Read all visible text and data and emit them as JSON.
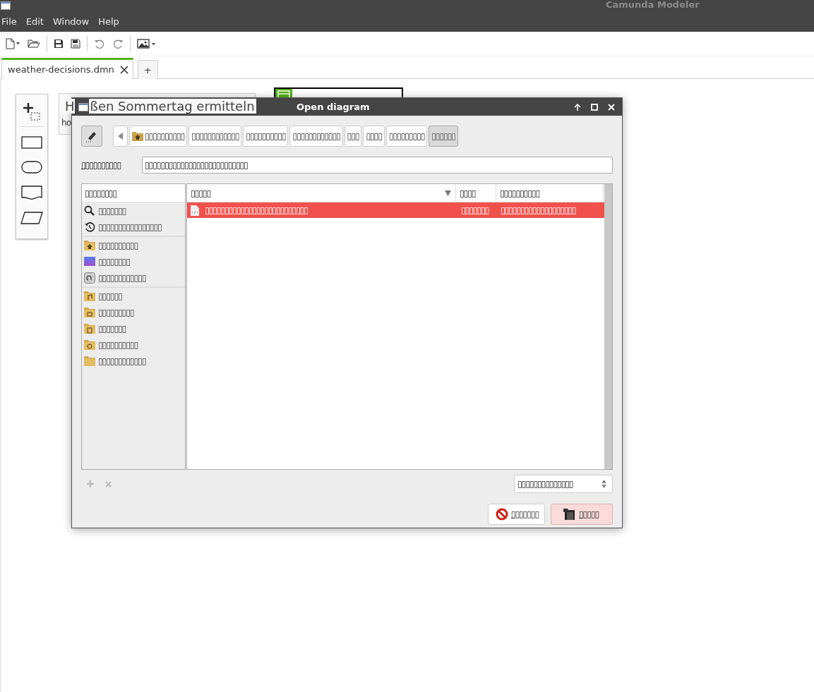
{
  "app_title": "Camunda Modeler",
  "menu": [
    "File",
    "Edit",
    "Window",
    "Help"
  ],
  "tabs": [
    {
      "label": "weather-decisions.dmn",
      "selected": true,
      "closable": true
    },
    {
      "label": "+",
      "selected": false,
      "closable": false
    }
  ],
  "canvas": {
    "node_title_parts": [
      "H",
      "ßen Sommertag ermitteln"
    ],
    "node_subtitle": "ho"
  },
  "dialog": {
    "title": "Open diagram",
    "breadcrumbs": [
      {
        "label": "▯▯▯▯▯▯▯▯▯▯",
        "kind": "home",
        "selected": false
      },
      {
        "label": "▯▯▯▯▯▯▯▯▯▯▯▯",
        "kind": "plain",
        "selected": false
      },
      {
        "label": "▯▯▯▯▯▯▯▯▯▯",
        "kind": "plain",
        "selected": false
      },
      {
        "label": "▯▯▯▯▯▯▯▯▯▯▯▯",
        "kind": "plain",
        "selected": false
      },
      {
        "label": "▯▯▯",
        "kind": "plain",
        "selected": false
      },
      {
        "label": "▯▯▯▯",
        "kind": "plain",
        "selected": false
      },
      {
        "label": "▯▯▯▯▯▯▯▯▯",
        "kind": "plain",
        "selected": false
      },
      {
        "label": "▯▯▯▯▯▯",
        "kind": "plain",
        "selected": true
      }
    ],
    "location_label": "▯▯▯▯▯▯▯▯▯▯",
    "location_value": "▯▯▯▯▯▯▯▯▯▯▯▯▯▯▯▯▯▯▯▯▯▯▯▯▯▯",
    "places_header": "▯▯▯▯▯▯▯▯",
    "places": [
      [
        {
          "label": "▯▯▯▯▯▯▯",
          "kind": "search"
        },
        {
          "label": "▯▯▯▯▯▯▯▯▯▯▯▯▯▯▯▯",
          "kind": "recent"
        }
      ],
      [
        {
          "label": "▯▯▯▯▯▯▯▯▯▯",
          "kind": "home"
        },
        {
          "label": "▯▯▯▯▯▯▯▯",
          "kind": "desktop"
        },
        {
          "label": "▯▯▯▯▯▯▯▯▯▯▯▯",
          "kind": "drive"
        }
      ],
      [
        {
          "label": "▯▯▯▯▯▯",
          "kind": "music"
        },
        {
          "label": "▯▯▯▯▯▯▯▯▯",
          "kind": "pictures"
        },
        {
          "label": "▯▯▯▯▯▯▯",
          "kind": "videos"
        },
        {
          "label": "▯▯▯▯▯▯▯▯▯▯",
          "kind": "downloads"
        },
        {
          "label": "▯▯▯▯▯▯▯▯▯▯▯▯",
          "kind": "folder"
        }
      ]
    ],
    "columns": [
      {
        "label": "▯▯▯▯▯",
        "sorted": true
      },
      {
        "label": "▯▯▯▯",
        "sorted": false
      },
      {
        "label": "▯▯▯▯▯▯▯▯▯▯",
        "sorted": false
      }
    ],
    "files": [
      {
        "name": "▯▯▯▯▯▯▯▯▯▯▯▯▯▯▯▯▯▯▯▯▯▯▯▯▯▯",
        "size": "▯▯▯▯▯▯▯",
        "modified": "▯▯▯▯▯▯▯▯▯▯▯▯▯▯▯▯▯▯▯",
        "selected": true
      }
    ],
    "filter": "▯▯▯▯▯▯▯▯▯▯▯▯▯▯",
    "cancel": "▯▯▯▯▯▯▯",
    "open": "▯▯▯▯▯"
  }
}
